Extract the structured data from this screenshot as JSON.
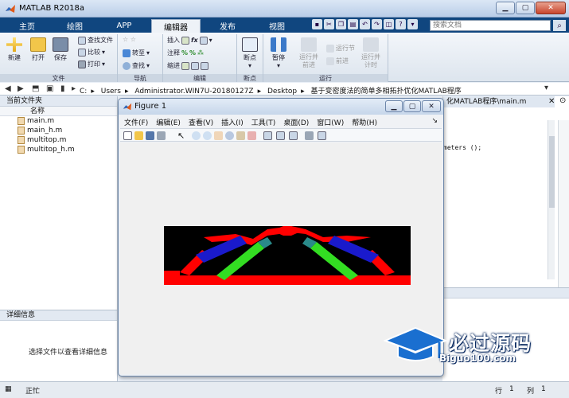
{
  "window": {
    "title": "MATLAB R2018a"
  },
  "tabs": [
    "主页",
    "绘图",
    "APP",
    "编辑器",
    "发布",
    "视图"
  ],
  "search": {
    "placeholder": "搜索文档"
  },
  "ribbon": {
    "file": {
      "new": "新建",
      "open": "打开",
      "save": "保存",
      "find_files": "查找文件",
      "compare": "比较",
      "print": "打印",
      "label": "文件"
    },
    "nav": {
      "goto": "转至",
      "find": "查找",
      "label": "导航"
    },
    "edit": {
      "insert": "插入",
      "comment": "注释",
      "indent": "缩进",
      "label": "编辑"
    },
    "breakpoints": {
      "bp": "断点",
      "label": "断点"
    },
    "run": {
      "pause": "暂停",
      "run_advance": "运行并前进",
      "run_section": "运行节",
      "advance": "前进",
      "run_time": "运行并计时",
      "label": "运行"
    }
  },
  "path": {
    "crumbs": [
      "C:",
      "Users",
      "Administrator.WIN7U-20180127Z",
      "Desktop",
      "基于变密度法的简单多相拓扑优化MATLAB程序"
    ]
  },
  "current_folder": {
    "title": "当前文件夹",
    "column": "名称",
    "files": [
      "main.m",
      "main_h.m",
      "multitop.m",
      "multitop_h.m"
    ]
  },
  "details": {
    "title": "详细信息",
    "hint": "选择文件以查看详细信息"
  },
  "editor": {
    "tab": "化MATLAB程序\\main.m",
    "code_fragment": "meters ();"
  },
  "figure": {
    "title": "Figure 1",
    "menu": [
      "文件(F)",
      "编辑(E)",
      "查看(V)",
      "插入(I)",
      "工具(T)",
      "桌面(D)",
      "窗口(W)",
      "帮助(H)"
    ]
  },
  "status": {
    "left": "正忙",
    "row_label": "行",
    "row": "1",
    "col_label": "列",
    "col": "1"
  },
  "watermark": {
    "text": "必过源码",
    "url": "Biguo100.com"
  },
  "colors": {
    "tabbar": "#10467f",
    "topo_red": "#ff0000",
    "topo_green": "#33dd22",
    "topo_blue": "#1a1acc"
  }
}
